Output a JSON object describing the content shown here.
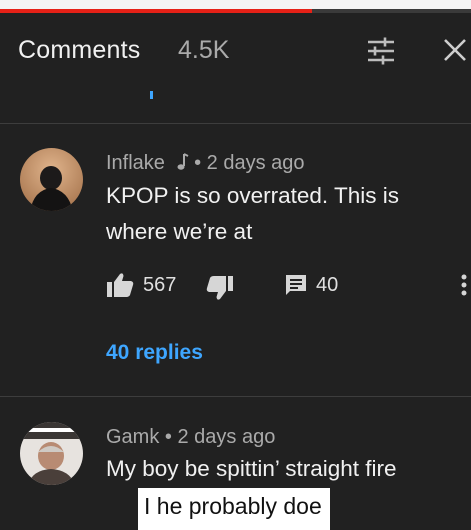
{
  "header": {
    "title": "Comments",
    "count": "4.5K",
    "filter_icon": "sort-icon",
    "close_icon": "close-icon"
  },
  "comments": [
    {
      "author": "Inflake",
      "author_badge_icon": "music-note-icon",
      "separator": "•",
      "time": "2 days ago",
      "text_line1": "KPOP is so overrated. This is",
      "text_line2": "where we’re at",
      "likes": "567",
      "replies_count": "40",
      "replies_link": "40 replies"
    },
    {
      "author": "Gamk",
      "separator": "•",
      "time": "2 days ago",
      "text_line1": "My boy be spittin’ straight fire"
    }
  ],
  "caption": {
    "text": "I he probably doe"
  },
  "colors": {
    "background": "#212121",
    "link": "#3ea6ff",
    "progress": "#e62117"
  }
}
